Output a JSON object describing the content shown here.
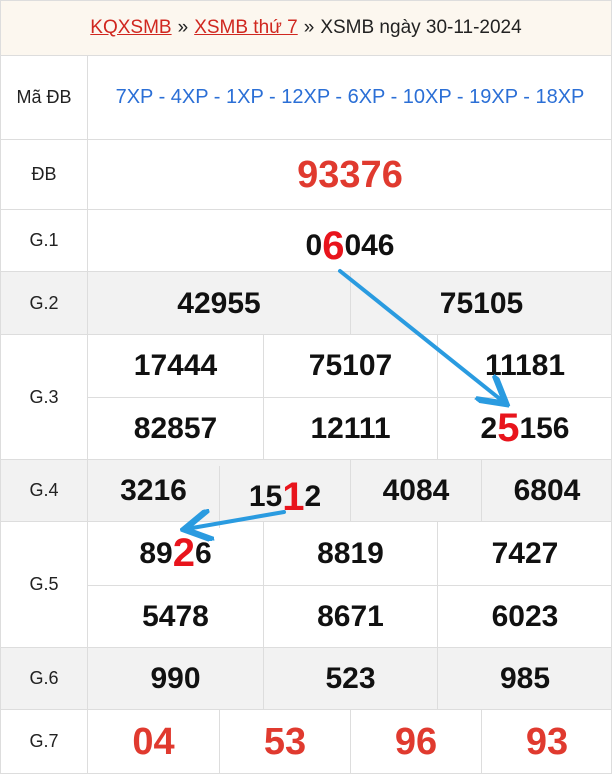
{
  "header": {
    "link1": "KQXSMB",
    "sep1": "»",
    "link2": "XSMB thứ 7",
    "sep2": "»",
    "title": "XSMB ngày 30-11-2024"
  },
  "ma_db": {
    "label": "Mã ĐB",
    "codes": "7XP - 4XP - 1XP - 12XP - 6XP - 10XP - 19XP - 18XP"
  },
  "db": {
    "label": "ĐB",
    "value": "93376"
  },
  "g1": {
    "label": "G.1",
    "pre": "0",
    "hl": "6",
    "post": "046"
  },
  "g2": {
    "label": "G.2",
    "values": [
      "42955",
      "75105"
    ]
  },
  "g3": {
    "label": "G.3",
    "values": [
      "17444",
      "75107",
      "11181",
      "82857",
      "12111"
    ],
    "last": {
      "pre": "2",
      "hl": "5",
      "post": "156"
    }
  },
  "g4": {
    "label": "G.4",
    "v0": "3216",
    "v1": {
      "pre": "15",
      "hl": "1",
      "post": "2"
    },
    "v2": "4084",
    "v3": "6804"
  },
  "g5": {
    "label": "G.5",
    "first": {
      "pre": "89",
      "hl": "2",
      "post": "6"
    },
    "values": [
      "8819",
      "7427",
      "5478",
      "8671",
      "6023"
    ]
  },
  "g6": {
    "label": "G.6",
    "values": [
      "990",
      "523",
      "985"
    ]
  },
  "g7": {
    "label": "G.7",
    "values": [
      "04",
      "53",
      "96",
      "93"
    ]
  },
  "colors": {
    "accent_red": "#e03a2f",
    "highlight_red": "#e8141c",
    "code_blue": "#2b6fd6",
    "arrow_blue": "#2a9be0",
    "header_bg": "#fcf7ef",
    "alt_row_bg": "#f2f2f2"
  }
}
